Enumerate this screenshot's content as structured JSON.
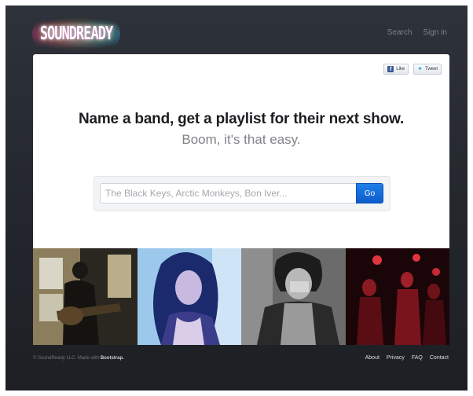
{
  "header": {
    "logo_text": "SOUNDREADY",
    "nav": {
      "search": "Search",
      "sign_in": "Sign in"
    }
  },
  "social": {
    "like": {
      "icon": "facebook-icon",
      "label": "Like"
    },
    "tweet": {
      "icon": "twitter-bird-icon",
      "label": "Tweet"
    }
  },
  "hero": {
    "headline": "Name a band, get a playlist for their next show.",
    "subhead": "Boom, it's that easy."
  },
  "search": {
    "placeholder": "The Black Keys, Arctic Monkeys, Bon Iver...",
    "button_label": "Go"
  },
  "footer": {
    "copyright": "© SoundReady LLC. Made with ",
    "brand": "Bootstrap.",
    "links": {
      "about": "About",
      "privacy": "Privacy",
      "faq": "FAQ",
      "contact": "Contact"
    }
  },
  "colors": {
    "background": "#23262d",
    "accent_button": "#0d5ccc",
    "headline": "#1b1d21",
    "subhead": "#808388"
  }
}
